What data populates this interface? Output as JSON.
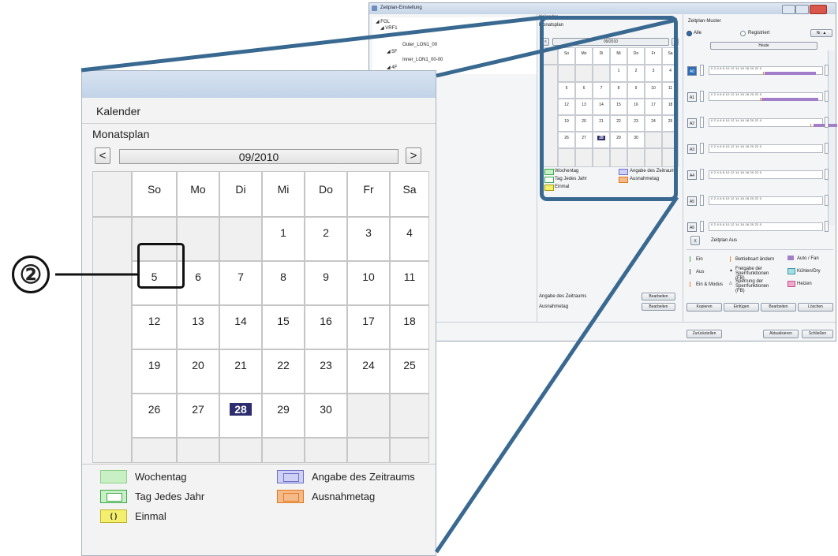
{
  "window": {
    "title": "Zeitplan-Einstellung",
    "tree": {
      "root": "FGL",
      "node1": "VRF1",
      "leaf1": "Outer_LON1_00",
      "node2": "5F",
      "leaf2": "Inner_LON1_00-00",
      "node3": "4F"
    },
    "calendar_panel": {
      "label": "Kalender",
      "subtitle": "Monatsplan",
      "month": "09/2010",
      "prev": "<",
      "next": ">"
    },
    "pattern_panel": {
      "label": "Zeitplan-Muster",
      "radio_all": "Alle",
      "radio_registered": "Registriert",
      "sort_button": "Nr. ▲",
      "today_label": "Heute",
      "patterns": [
        "A0",
        "A1",
        "A2",
        "A3",
        "A4",
        "A5",
        "A6"
      ],
      "ticks": "0  2  4  6  8  10  12  14  16  18  20  22  0",
      "off_button": "X",
      "off_label": "Zeitplan Aus",
      "legend": {
        "on": "Ein",
        "off": "Aus",
        "on_mode": "Ein & Modus",
        "change_mode": "Betriebsart ändern",
        "release": "Freigabe der Sperrfunktionen (FB)",
        "lock": "Sperrung der Sperrfunktionen (FB)",
        "auto": "Auto / Fan",
        "cool": "Kühlen/Dry",
        "heat": "Heizen"
      }
    },
    "bottom_left": {
      "period_label": "Angabe des Zeitraums",
      "exception_label": "Ausnahmetag",
      "edit_button": "Bearbeiten"
    },
    "buttons": {
      "copy": "Kopieren",
      "paste": "Einfügen",
      "edit": "Bearbeiten",
      "delete": "Löschen",
      "reset": "Zurückstellen",
      "refresh": "Aktualisieren",
      "close": "Schließen"
    }
  },
  "zoom": {
    "kalender": "Kalender",
    "monatsplan": "Monatsplan",
    "month": "09/2010",
    "prev": "<",
    "next": ">",
    "weekdays": [
      "So",
      "Mo",
      "Di",
      "Mi",
      "Do",
      "Fr",
      "Sa"
    ],
    "weeks": [
      [
        "",
        "",
        "",
        "1",
        "2",
        "3",
        "4"
      ],
      [
        "5",
        "6",
        "7",
        "8",
        "9",
        "10",
        "11"
      ],
      [
        "12",
        "13",
        "14",
        "15",
        "16",
        "17",
        "18"
      ],
      [
        "19",
        "20",
        "21",
        "22",
        "23",
        "24",
        "25"
      ],
      [
        "26",
        "27",
        "28",
        "29",
        "30",
        "",
        ""
      ],
      [
        "",
        "",
        "",
        "",
        "",
        "",
        ""
      ]
    ],
    "today": "28",
    "legend": {
      "weekday": "Wochentag",
      "yearly": "Tag Jedes Jahr",
      "once": "Einmal",
      "once_symbol": "( )",
      "period": "Angabe des Zeitraums",
      "exception": "Ausnahmetag"
    }
  },
  "callout": {
    "marker": "②"
  },
  "colors": {
    "callout": "#396990",
    "today_bg": "#2c2c6e",
    "legend_green": "#c9efc4",
    "legend_green_border": "#3aa84a",
    "legend_blue": "#cfd0f5",
    "legend_orange": "#f6b98a",
    "legend_yellow": "#f4ef6c",
    "bar_purple": "#a47fc9"
  }
}
